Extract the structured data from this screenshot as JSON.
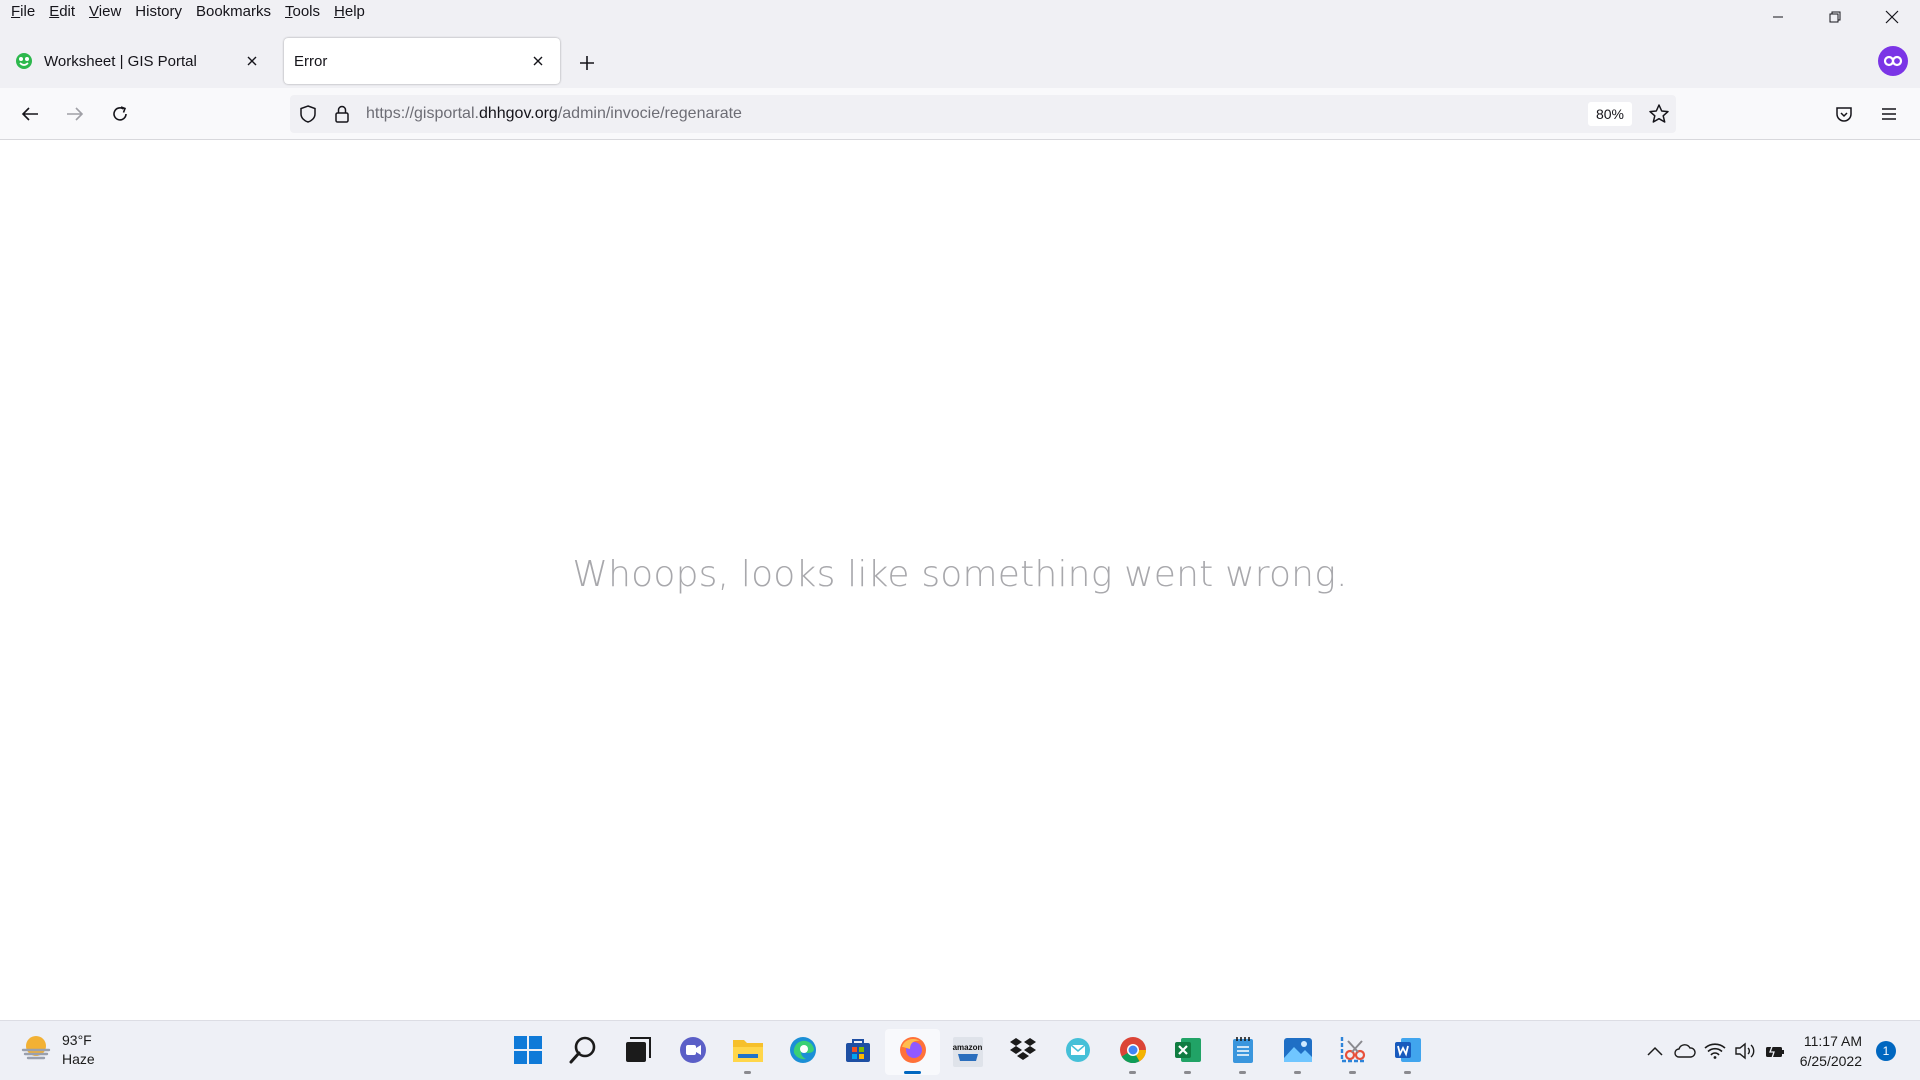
{
  "menubar": {
    "items": [
      {
        "accel": "F",
        "rest": "ile"
      },
      {
        "accel": "E",
        "rest": "dit"
      },
      {
        "accel": "V",
        "rest": "iew"
      },
      {
        "accel": "",
        "rest": "History"
      },
      {
        "accel": "",
        "rest": "Bookmarks"
      },
      {
        "accel": "T",
        "rest": "ools"
      },
      {
        "accel": "H",
        "rest": "elp"
      }
    ]
  },
  "tabs": [
    {
      "title": "Worksheet | GIS Portal",
      "active": false
    },
    {
      "title": "Error",
      "active": true
    }
  ],
  "navbar": {
    "url_prefix": "https://gisportal.",
    "url_domain": "dhhgov.org",
    "url_path": "/admin/invocie/regenarate",
    "zoom": "80%"
  },
  "page": {
    "message": "Whoops, looks like something went wrong."
  },
  "taskbar": {
    "weather_temp": "93°F",
    "weather_desc": "Haze",
    "apps": [
      "start-icon",
      "search-icon",
      "task-view-icon",
      "teams-chat-icon",
      "file-explorer-icon",
      "edge-icon",
      "store-icon",
      "firefox-icon",
      "amazon-icon",
      "dropbox-icon",
      "mail-icon",
      "chrome-icon",
      "excel-icon",
      "notepad-icon",
      "photos-icon",
      "snipping-tool-icon",
      "word-icon"
    ],
    "amazon_label": "amazon",
    "time": "11:17 AM",
    "date": "6/25/2022",
    "notification_count": "1"
  },
  "colors": {
    "accent": "#0067c0",
    "account": "#7b35e6",
    "error_text": "#a8a8ac"
  }
}
